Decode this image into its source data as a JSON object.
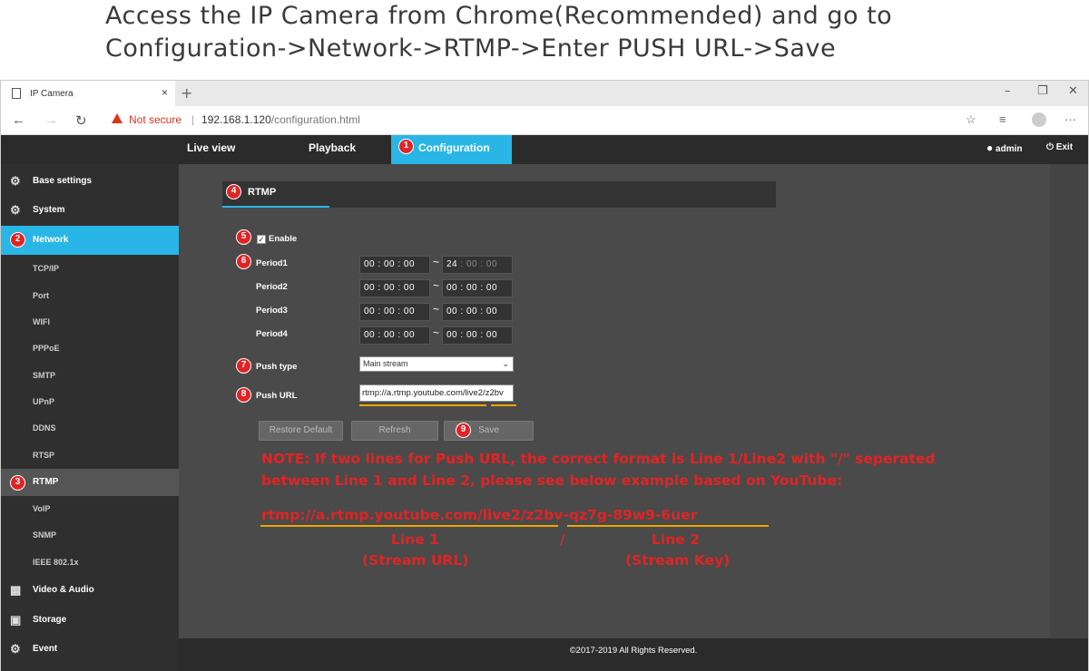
{
  "caption": {
    "line1": "Access the IP Camera from Chrome(Recommended) and go to",
    "line2": "Configuration->Network->RTMP->Enter PUSH URL->Save"
  },
  "browser": {
    "tab_title": "IP Camera",
    "tab_close": "×",
    "new_tab": "+",
    "not_secure": "Not secure",
    "url_host": "192.168.1.120",
    "url_path": "/configuration.html"
  },
  "topnav": {
    "live_view": "Live view",
    "playback": "Playback",
    "configuration": "Configuration",
    "user": "admin",
    "exit": "Exit"
  },
  "sidebar": {
    "base_settings": "Base settings",
    "system": "System",
    "network": "Network",
    "sub": [
      "TCP/IP",
      "Port",
      "WIFI",
      "PPPoE",
      "SMTP",
      "UPnP",
      "DDNS",
      "RTSP",
      "RTMP",
      "VoIP",
      "SNMP",
      "IEEE 802.1x"
    ],
    "video_audio": "Video & Audio",
    "storage": "Storage",
    "event": "Event"
  },
  "badges": [
    "1",
    "2",
    "3",
    "4",
    "5",
    "6",
    "7",
    "8",
    "9"
  ],
  "form": {
    "tab": "RTMP",
    "enable": "Enable",
    "periods": [
      {
        "label": "Period1",
        "start": "00 : 00 : 00",
        "end_h": "24",
        "end_rest": " : 00 : 00"
      },
      {
        "label": "Period2",
        "start": "00 : 00 : 00",
        "end_h": "00",
        "end_rest": " : 00 : 00"
      },
      {
        "label": "Period3",
        "start": "00 : 00 : 00",
        "end_h": "00",
        "end_rest": " : 00 : 00"
      },
      {
        "label": "Period4",
        "start": "00 : 00 : 00",
        "end_h": "00",
        "end_rest": " : 00 : 00"
      }
    ],
    "tilde": "~",
    "push_type_label": "Push type",
    "push_type_value": "Main stream",
    "push_url_label": "Push URL",
    "push_url_value": "rtmp://a.rtmp.youtube.com/live2/z2bv",
    "restore_default": "Restore Default",
    "refresh": "Refresh",
    "save": "Save"
  },
  "note": {
    "line1": "NOTE: If two lines for Push URL, the correct format is Line 1/Line2 with \"/\" seperated",
    "line2": "between Line 1 and Line 2, please see below example based on YouTube:",
    "example_url": "rtmp://a.rtmp.youtube.com/live2/z2bv-qz7g-89w9-6uer",
    "line1_label": "Line 1",
    "line1_sub": "(Stream URL)",
    "slash": "/",
    "line2_label": "Line 2",
    "line2_sub": "(Stream Key)"
  },
  "footer": "©2017-2019 All Rights Reserved.",
  "colors": {
    "accent": "#29b6e6",
    "badge": "#e02424",
    "underline": "#f0a500"
  }
}
